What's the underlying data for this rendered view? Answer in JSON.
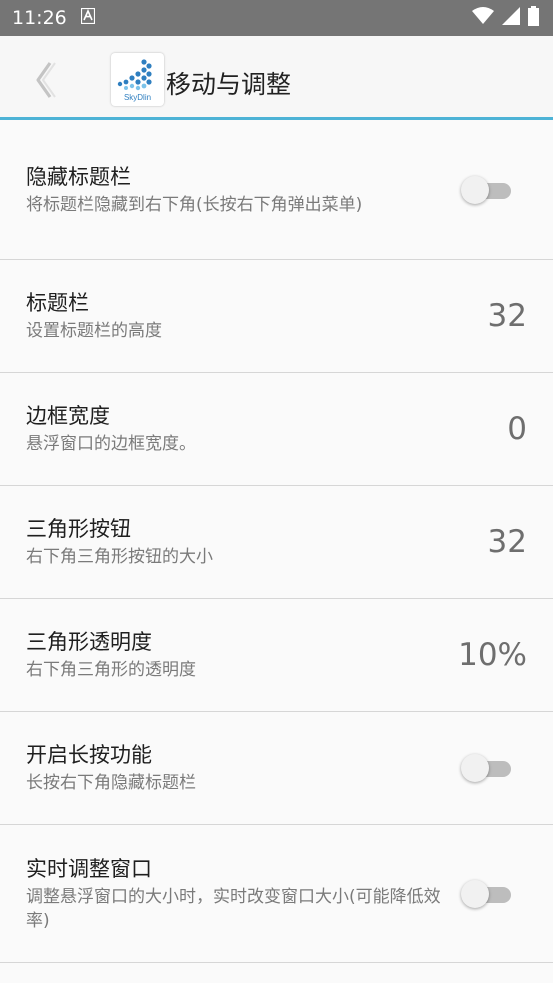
{
  "status_bar": {
    "time": "11:26",
    "notification_icon": "a-icon",
    "icons": [
      "wifi-icon",
      "signal-icon",
      "battery-icon"
    ]
  },
  "header": {
    "back_icon": "chevron-left-icon",
    "logo_icon": "skydlin-logo",
    "logo_text": "SkyDlin",
    "title": "移动与调整"
  },
  "settings": [
    {
      "title": "隐藏标题栏",
      "summary": "将标题栏隐藏到右下角(长按右下角弹出菜单)",
      "control": "switch",
      "checked": false
    },
    {
      "title": "标题栏",
      "summary": "设置标题栏的高度",
      "control": "value",
      "value": "32"
    },
    {
      "title": "边框宽度",
      "summary": "悬浮窗口的边框宽度。",
      "control": "value",
      "value": "0"
    },
    {
      "title": "三角形按钮",
      "summary": "右下角三角形按钮的大小",
      "control": "value",
      "value": "32"
    },
    {
      "title": "三角形透明度",
      "summary": "右下角三角形的透明度",
      "control": "value",
      "value": "10%"
    },
    {
      "title": "开启长按功能",
      "summary": "长按右下角隐藏标题栏",
      "control": "switch",
      "checked": false
    },
    {
      "title": "实时调整窗口",
      "summary": "调整悬浮窗口的大小时，实时改变窗口大小(可能降低效率)",
      "control": "switch",
      "checked": false
    }
  ],
  "colors": {
    "status_bar": "#757575",
    "accent_line": "#4db3d6",
    "switch_track": "#bdbdbd",
    "switch_thumb": "#f1f1f1"
  }
}
